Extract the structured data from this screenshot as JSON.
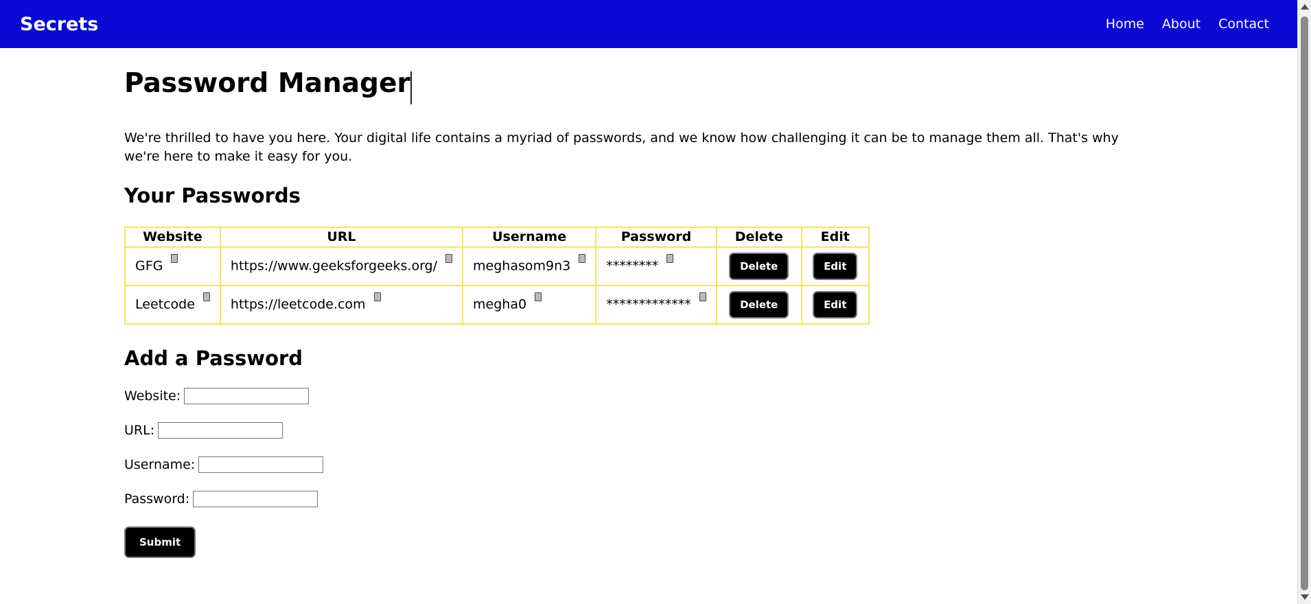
{
  "nav": {
    "brand": "Secrets",
    "links": [
      "Home",
      "About",
      "Contact"
    ]
  },
  "page": {
    "title": "Password Manager",
    "intro": "We're thrilled to have you here. Your digital life contains a myriad of passwords, and we know how challenging it can be to manage them all. That's why we're here to make it easy for you."
  },
  "passwords": {
    "heading": "Your Passwords",
    "columns": [
      "Website",
      "URL",
      "Username",
      "Password",
      "Delete",
      "Edit"
    ],
    "rows": [
      {
        "website": "GFG",
        "url": "https://www.geeksforgeeks.org/",
        "username": "meghasom9n3",
        "password": "********",
        "delete_label": "Delete",
        "edit_label": "Edit"
      },
      {
        "website": "Leetcode",
        "url": "https://leetcode.com",
        "username": "megha0",
        "password": "*************",
        "delete_label": "Delete",
        "edit_label": "Edit"
      }
    ]
  },
  "form": {
    "heading": "Add a Password",
    "fields": [
      {
        "label": "Website:",
        "value": ""
      },
      {
        "label": "URL:",
        "value": ""
      },
      {
        "label": "Username:",
        "value": ""
      },
      {
        "label": "Password:",
        "value": ""
      }
    ],
    "submit_label": "Submit"
  },
  "colors": {
    "navbar": "#0a0ad4",
    "table_border": "#ecea5a",
    "button": "#000000"
  }
}
